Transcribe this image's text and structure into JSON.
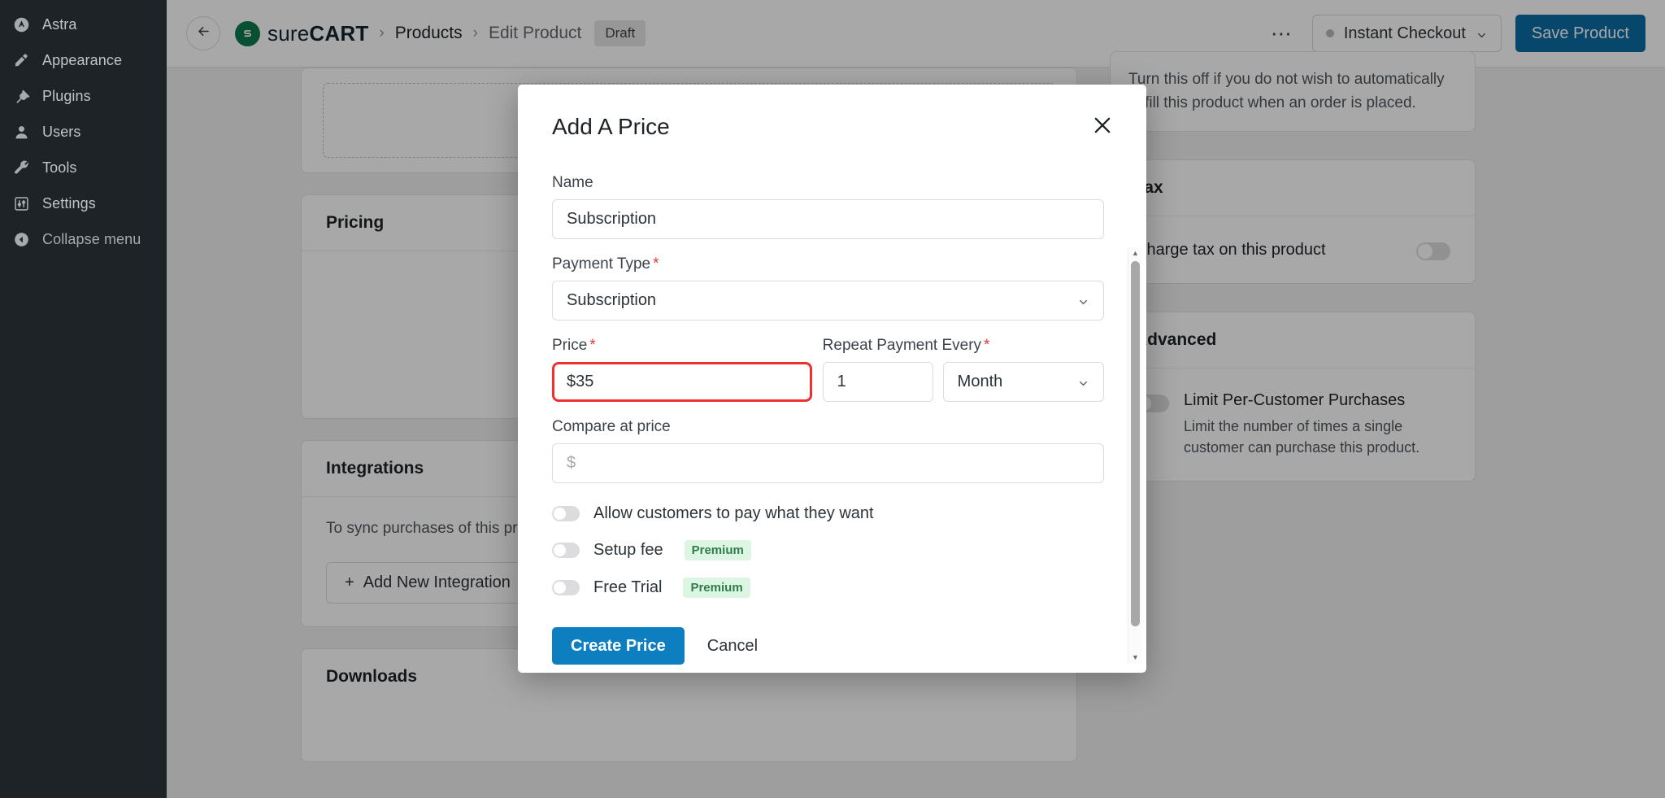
{
  "wp_sidebar": {
    "items": [
      {
        "label": "Astra",
        "icon": "astra-logo-icon"
      },
      {
        "label": "Appearance",
        "icon": "paintbrush-icon"
      },
      {
        "label": "Plugins",
        "icon": "plug-icon"
      },
      {
        "label": "Users",
        "icon": "user-icon"
      },
      {
        "label": "Tools",
        "icon": "wrench-icon"
      },
      {
        "label": "Settings",
        "icon": "sliders-icon"
      },
      {
        "label": "Collapse menu",
        "icon": "collapse-arrow-icon"
      }
    ]
  },
  "header": {
    "back_icon": "arrow-left-icon",
    "brand_prefix": "sure",
    "brand_suffix": "CART",
    "brand_icon": "surecart-logo-icon",
    "breadcrumb": [
      {
        "label": "Products"
      },
      {
        "label": "Edit Product"
      }
    ],
    "separator": "›",
    "status_badge": "Draft",
    "kebab_icon": "more-horizontal-icon",
    "checkout_select": {
      "value": "Instant Checkout",
      "chevron_icon": "chevron-down-icon",
      "dot_color": "#b5b8bb"
    },
    "save_label": "Save Product",
    "save_color": "#0d6ca5"
  },
  "main": {
    "media_card": {
      "has_dashed_dropzone": true
    },
    "pricing_card": {
      "title": "Pricing"
    },
    "integrations_card": {
      "title": "Integrations",
      "description": "To sync purchases of this product",
      "add_label": "Add New Integration",
      "add_icon": "plus-icon"
    },
    "downloads_card": {
      "title": "Downloads"
    }
  },
  "sidebar_right": {
    "fulfillment_note": "Turn this off if you do not wish to automatically fulfill this product when an order is placed.",
    "tax_card": {
      "title": "Tax",
      "toggle_label": "Charge tax on this product",
      "toggle_on": false
    },
    "advanced_card": {
      "title": "Advanced",
      "toggle_label": "Limit Per-Customer Purchases",
      "toggle_desc": "Limit the number of times a single customer can purchase this product.",
      "toggle_on": false
    }
  },
  "modal": {
    "title": "Add A Price",
    "close_icon": "close-icon",
    "fields": {
      "name": {
        "label": "Name",
        "value": "Subscription",
        "required": false
      },
      "payment_type": {
        "label": "Payment Type",
        "required": true,
        "value": "Subscription",
        "chevron_icon": "chevron-down-icon"
      },
      "price": {
        "label": "Price",
        "required": true,
        "currency": "$",
        "value": "35",
        "highlighted": true,
        "highlight_color": "#f03030"
      },
      "repeat_every": {
        "label": "Repeat Payment Every",
        "required": true,
        "count": "1",
        "interval": "Month",
        "chevron_icon": "chevron-down-icon"
      },
      "compare_at_price": {
        "label": "Compare at price",
        "required": false,
        "currency": "$",
        "value": "",
        "placeholder": ""
      }
    },
    "switches": [
      {
        "label": "Allow customers to pay what they want",
        "badge": "",
        "on": false
      },
      {
        "label": "Setup fee",
        "badge": "Premium",
        "on": false
      },
      {
        "label": "Free Trial",
        "badge": "Premium",
        "on": false
      }
    ],
    "badge_bg": "#ddf5e3",
    "badge_fg": "#2f7d4a",
    "submit_label": "Create Price",
    "submit_color": "#0d7ec0",
    "cancel_label": "Cancel"
  }
}
